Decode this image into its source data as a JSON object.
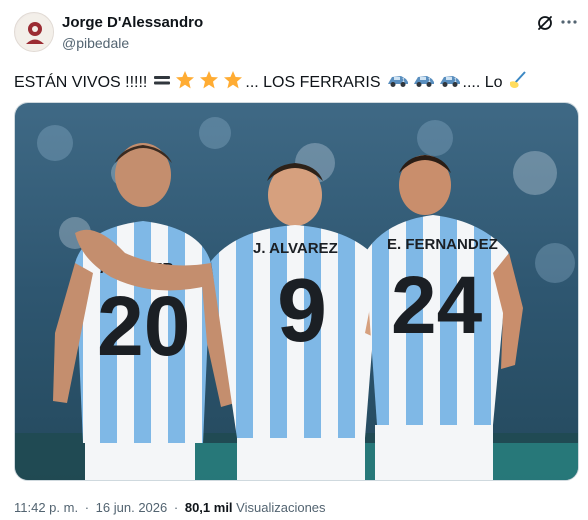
{
  "author": {
    "name": "Jorge D'Alessandro",
    "handle": "@pibedale"
  },
  "tweet": {
    "text_part1": "ESTÁN VIVOS !!!!!",
    "text_part2": "... LOS FERRARIS",
    "text_part3": ".... Lo",
    "emojis": [
      "equals-sign-emoji",
      "star-emoji",
      "star-emoji",
      "star-emoji",
      "racing-car-emoji",
      "racing-car-emoji",
      "racing-car-emoji",
      "writing-hand-emoji"
    ]
  },
  "media": {
    "players": [
      {
        "name": "MAC ALLISTER",
        "name_visible": "ALLISTER",
        "number": "20"
      },
      {
        "name": "J. ALVAREZ",
        "number": "9"
      },
      {
        "name": "E. FERNANDEZ",
        "number": "24"
      }
    ],
    "colors": {
      "sky_blue": "#7fb8e6",
      "shirt_white": "#f4f6f8",
      "stadium": "#2d5570",
      "number_black": "#1b1f24"
    }
  },
  "meta": {
    "time": "11:42 p. m.",
    "separator": "·",
    "date": "16 jun. 2026",
    "views_count": "80,1 mil",
    "views_label": "Visualizaciones"
  }
}
